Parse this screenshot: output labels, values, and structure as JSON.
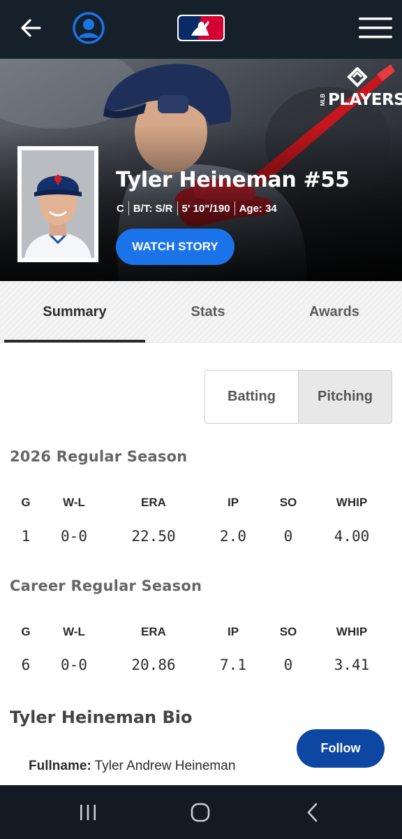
{
  "icons": {
    "back": "arrow-left-icon",
    "account": "user-circle-icon",
    "logo": "mlb-logo",
    "menu": "hamburger-menu-icon",
    "players_logo": "mlb-players-logo",
    "recents": "recent-apps-icon",
    "home": "home-icon",
    "nav_back": "chevron-left-icon"
  },
  "colors": {
    "topbar": "#16202b",
    "accent": "#1a73e8",
    "follow": "#0d47a1",
    "navbar": "#121a24"
  },
  "hero": {
    "players_brand": "PLAYERS",
    "players_brand_prefix": "MLB",
    "name": "Tyler Heineman #55",
    "position": "C",
    "bats_throws": "B/T: S/R",
    "height_weight": "5' 10\"/190",
    "age": "Age: 34",
    "watch_label": "WATCH STORY"
  },
  "tabs": [
    {
      "label": "Summary",
      "active": true
    },
    {
      "label": "Stats",
      "active": false
    },
    {
      "label": "Awards",
      "active": false
    }
  ],
  "toggle": {
    "batting": "Batting",
    "pitching": "Pitching",
    "selected": "Pitching"
  },
  "season": {
    "title": "2026 Regular Season",
    "headers": [
      "G",
      "W-L",
      "ERA",
      "IP",
      "SO",
      "WHIP"
    ],
    "values": [
      "1",
      "0-0",
      "22.50",
      "2.0",
      "0",
      "4.00"
    ]
  },
  "career": {
    "title": "Career Regular Season",
    "headers": [
      "G",
      "W-L",
      "ERA",
      "IP",
      "SO",
      "WHIP"
    ],
    "values": [
      "6",
      "0-0",
      "20.86",
      "7.1",
      "0",
      "3.41"
    ]
  },
  "bio": {
    "title": "Tyler Heineman Bio",
    "follow_label": "Follow",
    "fullname_label": "Fullname:",
    "fullname": "Tyler Andrew Heineman"
  }
}
